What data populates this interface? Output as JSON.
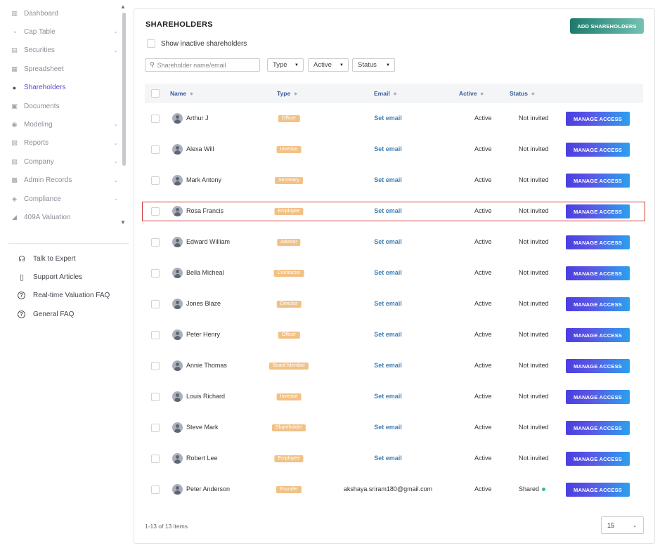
{
  "sidebar": {
    "items": [
      {
        "label": "Dashboard",
        "icon": "dashboard-icon",
        "glyph": "▥",
        "chevron": false,
        "active": false
      },
      {
        "label": "Cap Table",
        "icon": "pie-chart-icon",
        "glyph": "◔",
        "chevron": true,
        "active": false
      },
      {
        "label": "Securities",
        "icon": "clipboard-icon",
        "glyph": "▤",
        "chevron": true,
        "active": false
      },
      {
        "label": "Spreadsheet",
        "icon": "grid-icon",
        "glyph": "▦",
        "chevron": false,
        "active": false
      },
      {
        "label": "Shareholders",
        "icon": "person-icon",
        "glyph": "●",
        "chevron": false,
        "active": true
      },
      {
        "label": "Documents",
        "icon": "document-icon",
        "glyph": "▣",
        "chevron": false,
        "active": false
      },
      {
        "label": "Modeling",
        "icon": "bulb-icon",
        "glyph": "◉",
        "chevron": true,
        "active": false
      },
      {
        "label": "Reports",
        "icon": "report-icon",
        "glyph": "▧",
        "chevron": true,
        "active": false
      },
      {
        "label": "Company",
        "icon": "building-icon",
        "glyph": "▨",
        "chevron": true,
        "active": false
      },
      {
        "label": "Admin Records",
        "icon": "records-icon",
        "glyph": "▩",
        "chevron": true,
        "active": false
      },
      {
        "label": "Compliance",
        "icon": "shield-icon",
        "glyph": "◈",
        "chevron": true,
        "active": false
      },
      {
        "label": "409A Valuation",
        "icon": "valuation-icon",
        "glyph": "◢",
        "chevron": false,
        "active": false
      }
    ],
    "help": [
      {
        "label": "Talk to Expert",
        "icon": "headset-icon",
        "glyph": "☊"
      },
      {
        "label": "Support Articles",
        "icon": "book-icon",
        "glyph": "▯"
      },
      {
        "label": "Real-time Valuation FAQ",
        "icon": "question-icon",
        "glyph": "?"
      },
      {
        "label": "General FAQ",
        "icon": "question-icon",
        "glyph": "?"
      }
    ]
  },
  "main": {
    "title": "SHAREHOLDERS",
    "add_button": "ADD SHAREHOLDERS",
    "show_inactive_label": "Show inactive shareholders",
    "search_placeholder": "Shareholder name/email",
    "filters": {
      "type": "Type",
      "active": "Active",
      "status": "Status"
    },
    "columns": {
      "name": "Name",
      "type": "Type",
      "email": "Email",
      "active": "Active",
      "status": "Status"
    },
    "manage_label": "MANAGE ACCESS",
    "rows": [
      {
        "name": "Arthur J",
        "type": "Officer",
        "email": "Set email",
        "email_link": true,
        "active": "Active",
        "status": "Not invited",
        "status_dot": false
      },
      {
        "name": "Alexa Will",
        "type": "Investor",
        "email": "Set email",
        "email_link": true,
        "active": "Active",
        "status": "Not invited",
        "status_dot": false
      },
      {
        "name": "Mark Antony",
        "type": "Secretary",
        "email": "Set email",
        "email_link": true,
        "active": "Active",
        "status": "Not invited",
        "status_dot": false
      },
      {
        "name": "Rosa Francis",
        "type": "Employee",
        "email": "Set email",
        "email_link": true,
        "active": "Active",
        "status": "Not invited",
        "status_dot": false
      },
      {
        "name": "Edward William",
        "type": "Advisor",
        "email": "Set email",
        "email_link": true,
        "active": "Active",
        "status": "Not invited",
        "status_dot": false
      },
      {
        "name": "Bella Micheal",
        "type": "Contractor",
        "email": "Set email",
        "email_link": true,
        "active": "Active",
        "status": "Not invited",
        "status_dot": false
      },
      {
        "name": "Jones Blaze",
        "type": "Director",
        "email": "Set email",
        "email_link": true,
        "active": "Active",
        "status": "Not invited",
        "status_dot": false
      },
      {
        "name": "Peter Henry",
        "type": "Officer",
        "email": "Set email",
        "email_link": true,
        "active": "Active",
        "status": "Not invited",
        "status_dot": false
      },
      {
        "name": "Annie Thomas",
        "type": "Board Member",
        "email": "Set email",
        "email_link": true,
        "active": "Active",
        "status": "Not invited",
        "status_dot": false
      },
      {
        "name": "Louis Richard",
        "type": "Investor",
        "email": "Set email",
        "email_link": true,
        "active": "Active",
        "status": "Not invited",
        "status_dot": false
      },
      {
        "name": "Steve Mark",
        "type": "Shareholder",
        "email": "Set email",
        "email_link": true,
        "active": "Active",
        "status": "Not invited",
        "status_dot": false
      },
      {
        "name": "Robert Lee",
        "type": "Employee",
        "email": "Set email",
        "email_link": true,
        "active": "Active",
        "status": "Not invited",
        "status_dot": false
      },
      {
        "name": "Peter Anderson",
        "type": "Founder",
        "email": "akshaya.sriram180@gmail.com",
        "email_link": false,
        "active": "Active",
        "status": "Shared",
        "status_dot": true
      }
    ],
    "highlighted_row": "Rosa Francis",
    "footer": {
      "count": "1-13 of 13 items",
      "page_size": "15"
    }
  },
  "colors": {
    "accent": "#5b4bd1",
    "tag": "#f2c186",
    "link": "#3f7fb5",
    "highlight": "#d23a3a",
    "shared_dot": "#37b59a"
  }
}
